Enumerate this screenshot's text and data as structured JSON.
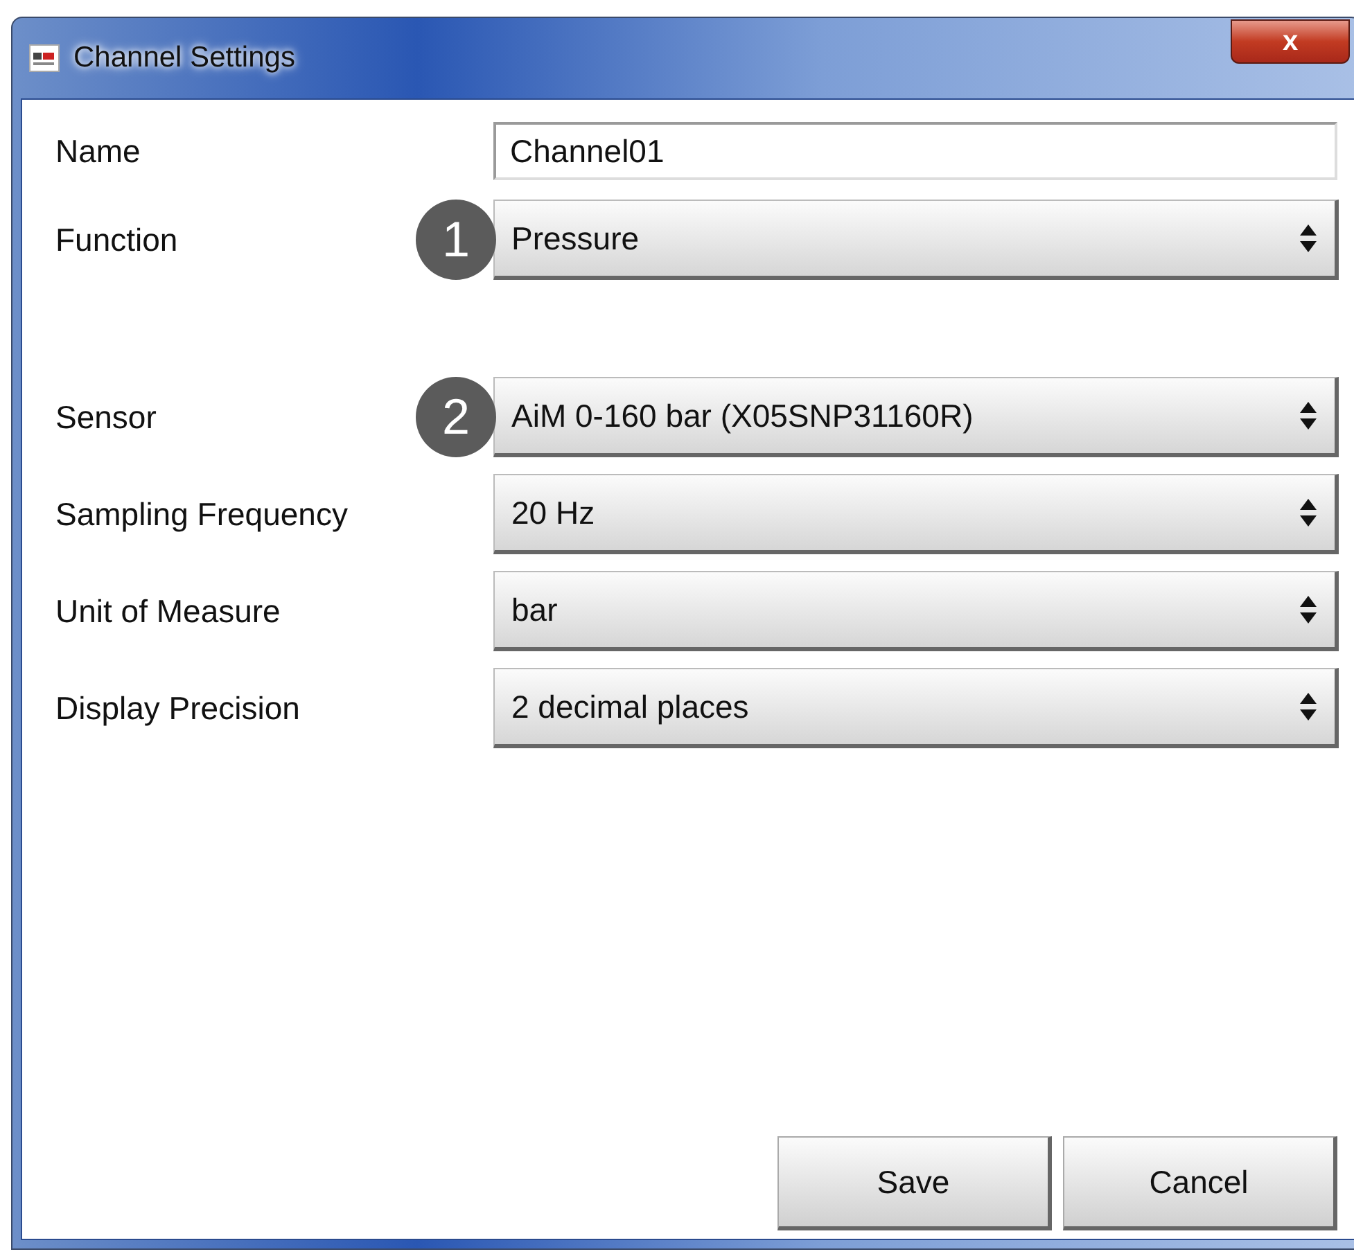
{
  "window": {
    "title": "Channel Settings",
    "close": "x"
  },
  "fields": [
    {
      "kind": "text",
      "label": "Name",
      "value": "Channel01"
    },
    {
      "kind": "select",
      "label": "Function",
      "value": "Pressure",
      "badge": "1"
    },
    {
      "kind": "spacer"
    },
    {
      "kind": "select",
      "label": "Sensor",
      "value": "AiM 0-160 bar (X05SNP31160R)",
      "badge": "2"
    },
    {
      "kind": "select",
      "label": "Sampling Frequency",
      "value": "20 Hz"
    },
    {
      "kind": "select",
      "label": "Unit of Measure",
      "value": "bar"
    },
    {
      "kind": "select",
      "label": "Display Precision",
      "value": "2 decimal places"
    }
  ],
  "buttons": [
    "Save",
    "Cancel"
  ]
}
